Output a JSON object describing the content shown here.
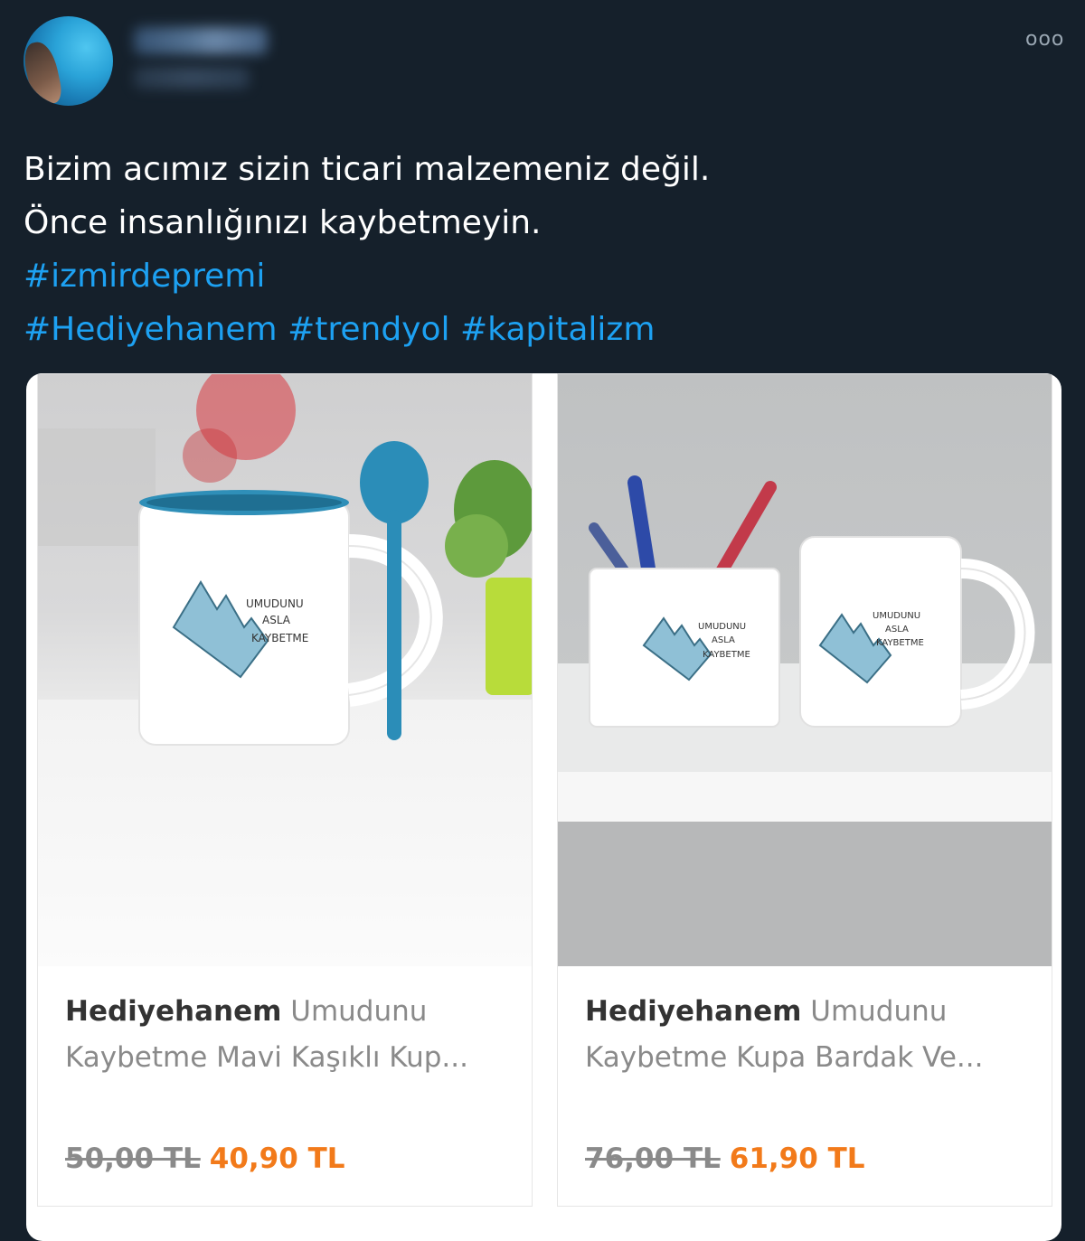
{
  "tweet": {
    "avatar_icon": "profile-avatar",
    "more_icon": "more-options-icon",
    "more_glyph": "ooo",
    "lines": [
      "Bizim acımız sizin ticari malzemeniz değil.",
      "Önce insanlığınızı kaybetmeyin."
    ],
    "hashtags_line1": [
      "#izmirdepremi"
    ],
    "hashtags_line2": [
      "#Hediyehanem",
      "#trendyol",
      "#kapitalizm"
    ],
    "link_color": "#1da1f2"
  },
  "products": [
    {
      "brand": "Hediyehanem",
      "title_part1": "Umudunu",
      "title_line2": "Kaybetme Mavi Kaşıklı Kup...",
      "old_price": "50,00 TL",
      "new_price": "40,90 TL",
      "print_text": [
        "UMUDUNU",
        "ASLA",
        "KAYBETME"
      ]
    },
    {
      "brand": "Hediyehanem",
      "title_part1": "Umudunu",
      "title_line2": "Kaybetme Kupa Bardak Ve...",
      "old_price": "76,00 TL",
      "new_price": "61,90 TL",
      "print_text": [
        "UMUDUNU",
        "ASLA",
        "KAYBETME"
      ]
    }
  ],
  "colors": {
    "background": "#15202b",
    "price_accent": "#f27a1a"
  }
}
